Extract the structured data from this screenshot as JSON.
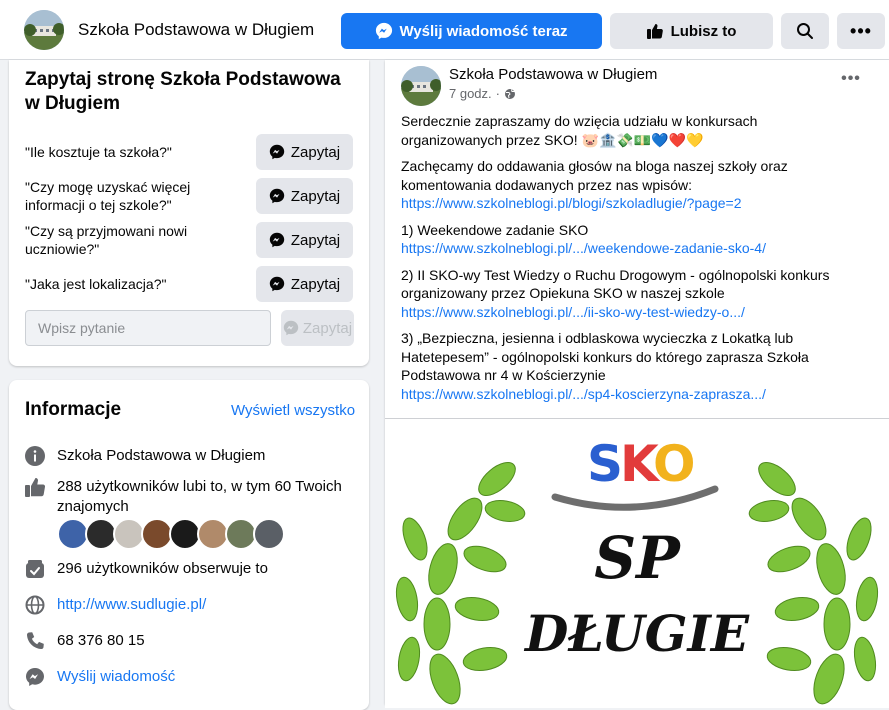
{
  "topbar": {
    "page_name": "Szkoła Podstawowa w Długiem",
    "send_label": "Wyślij wiadomość teraz",
    "like_label": "Lubisz to",
    "search_icon": "search-icon",
    "more_icon": "more-icon"
  },
  "ask": {
    "title": "Zapytaj stronę Szkoła Podstawowa w Długiem",
    "questions": [
      {
        "text": "\"Ile kosztuje ta szkoła?\"",
        "button": "Zapytaj"
      },
      {
        "text": "\"Czy mogę uzyskać więcej informacji o tej szkole?\"",
        "button": "Zapytaj"
      },
      {
        "text": "\"Czy są przyjmowani nowi uczniowie?\"",
        "button": "Zapytaj"
      },
      {
        "text": "\"Jaka jest lokalizacja?\"",
        "button": "Zapytaj"
      }
    ],
    "input_placeholder": "Wpisz pytanie",
    "submit_label": "Zapytaj"
  },
  "info": {
    "title": "Informacje",
    "see_all": "Wyświetl wszystko",
    "category": "Szkoła Podstawowa w Długiem",
    "likes": "288 użytkowników lubi to, w tym 60 Twoich znajomych",
    "followers": "296 użytkowników obserwuje to",
    "website": "http://www.sudlugie.pl/",
    "phone": "68 376 80 15",
    "message": "Wyślij wiadomość"
  },
  "post": {
    "author": "Szkoła Podstawowa w Długiem",
    "time": "7 godz.",
    "p1": "Serdecznie zapraszamy do wzięcia udziału w konkursach organizowanych przez SKO! 🐷🏦💸💵💙❤️💛",
    "p2": "Zachęcamy do oddawania głosów na bloga naszej szkoły oraz komentowania dodawanych przez nas wpisów:",
    "link1": "https://www.szkolneblogi.pl/blogi/szkoladlugie/?page=2",
    "item1": "1) Weekendowe zadanie SKO",
    "link2": "https://www.szkolneblogi.pl/.../weekendowe-zadanie-sko-4/",
    "item2": "2) II SKO-wy Test Wiedzy o Ruchu Drogowym - ogólnopolski konkurs organizowany przez Opiekuna SKO w naszej szkole",
    "link3": "https://www.szkolneblogi.pl/.../ii-sko-wy-test-wiedzy-o.../",
    "item3": "3)  „Bezpieczna, jesienna i odblaskowa wycieczka  z Lokatką lub Hatetepesem” - ogólnopolski konkurs do którego zaprasza Szkoła Podstawowa nr 4 w Kościerzynie",
    "link4": "https://www.szkolneblogi.pl/.../sp4-koscierzyna-zaprasza.../",
    "image": {
      "logo_text": "SKO",
      "line1": "SP",
      "line2": "DŁUGIE"
    }
  },
  "colors": {
    "brand": "#1877f2",
    "background": "#f0f2f5",
    "button_gray": "#e4e6eb",
    "secondary_text": "#65676b",
    "leaf_green": "#7cc23a"
  }
}
